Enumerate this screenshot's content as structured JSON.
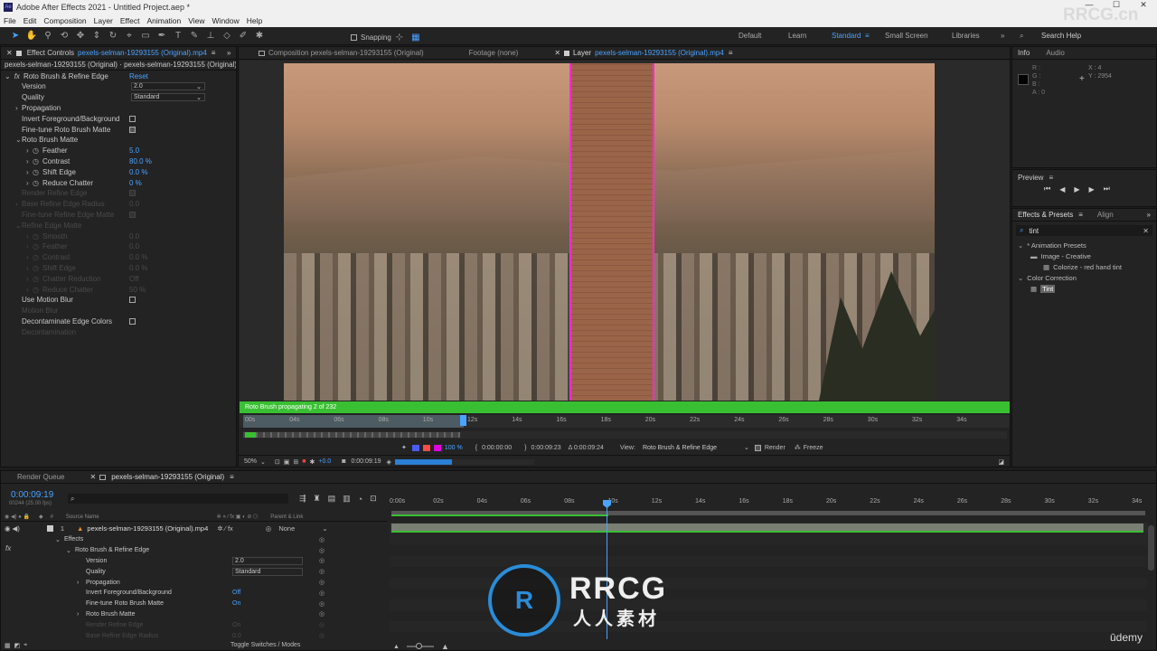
{
  "titlebar": {
    "title": "Adobe After Effects 2021 - Untitled Project.aep *",
    "minimize": "—",
    "maximize": "☐",
    "close": "✕"
  },
  "menu": [
    "File",
    "Edit",
    "Composition",
    "Layer",
    "Effect",
    "Animation",
    "View",
    "Window",
    "Help"
  ],
  "toolbar": {
    "snapping": "Snapping"
  },
  "workspaces": [
    "Default",
    "Learn",
    "Standard",
    "Small Screen",
    "Libraries"
  ],
  "search_help": "Search Help",
  "effect_controls": {
    "tab": "Effect Controls",
    "tab_file": "pexels-selman-19293155 (Original).mp4",
    "header": "pexels-selman-19293155 (Original) · pexels-selman-19293155 (Original).mp4",
    "effect_name": "Roto Brush & Refine Edge",
    "reset": "Reset",
    "rows": [
      {
        "label": "Version",
        "value": "2.0",
        "kind": "dropdown",
        "indent": 1
      },
      {
        "label": "Quality",
        "value": "Standard",
        "kind": "dropdown",
        "indent": 1
      },
      {
        "label": "Propagation",
        "value": "",
        "kind": "group",
        "indent": 1
      },
      {
        "label": "Invert Foreground/Background",
        "value": "",
        "kind": "checkbox",
        "indent": 1
      },
      {
        "label": "Fine-tune Roto Brush Matte",
        "value": "",
        "kind": "checkbox-on",
        "indent": 1
      },
      {
        "label": "Roto Brush Matte",
        "value": "",
        "kind": "group-open",
        "indent": 1
      },
      {
        "label": "Feather",
        "value": "5.0",
        "kind": "num",
        "indent": 2
      },
      {
        "label": "Contrast",
        "value": "80.0 %",
        "kind": "num",
        "indent": 2
      },
      {
        "label": "Shift Edge",
        "value": "0.0 %",
        "kind": "num",
        "indent": 2
      },
      {
        "label": "Reduce Chatter",
        "value": "0 %",
        "kind": "num",
        "indent": 2
      },
      {
        "label": "Render Refine Edge",
        "value": "",
        "kind": "checkbox-dim",
        "indent": 1
      },
      {
        "label": "Base Refine Edge Radius",
        "value": "0.0",
        "kind": "dim",
        "indent": 1
      },
      {
        "label": "Fine-tune Refine Edge Matte",
        "value": "",
        "kind": "checkbox-dim",
        "indent": 1
      },
      {
        "label": "Refine Edge Matte",
        "value": "",
        "kind": "dim",
        "indent": 1
      },
      {
        "label": "Smooth",
        "value": "0.0",
        "kind": "dim",
        "indent": 2
      },
      {
        "label": "Feather",
        "value": "0.0",
        "kind": "dim",
        "indent": 2
      },
      {
        "label": "Contrast",
        "value": "0.0 %",
        "kind": "dim",
        "indent": 2
      },
      {
        "label": "Shift Edge",
        "value": "0.0 %",
        "kind": "dim",
        "indent": 2
      },
      {
        "label": "Chatter Reduction",
        "value": "Off",
        "kind": "dim",
        "indent": 2
      },
      {
        "label": "Reduce Chatter",
        "value": "50 %",
        "kind": "dim",
        "indent": 2
      },
      {
        "label": "Use Motion Blur",
        "value": "",
        "kind": "checkbox",
        "indent": 1
      },
      {
        "label": "Motion Blur",
        "value": "",
        "kind": "dim",
        "indent": 1
      },
      {
        "label": "Decontaminate Edge Colors",
        "value": "",
        "kind": "checkbox",
        "indent": 1
      },
      {
        "label": "Decontamination",
        "value": "",
        "kind": "dim",
        "indent": 1
      }
    ]
  },
  "viewer": {
    "tab_comp": "Composition pexels-selman-19293155 (Original)",
    "tab_footage": "Footage (none)",
    "tab_layer": "Layer",
    "tab_layer_file": "pexels-selman-19293155 (Original).mp4",
    "status": "Roto Brush propagating 2 of 232",
    "status_progress": 1.0,
    "ruler": [
      "00s",
      "04s",
      "06s",
      "08s",
      "10s",
      "12s",
      "14s",
      "16s",
      "18s",
      "20s",
      "22s",
      "24s",
      "26s",
      "28s",
      "30s",
      "32s",
      "34s"
    ],
    "in_time": "0:00:00:00",
    "out_time": "0:00:09:23",
    "duration": "Δ 0:00:09:24",
    "zoom_pct": "100 %",
    "exposure": "+0.0",
    "view_label": "View:",
    "view_value": "Roto Brush & Refine Edge",
    "render": "Render",
    "freeze": "Freeze",
    "magnification": "50%",
    "current_time": "0:00:09:19",
    "cache_progress": 0.41
  },
  "info": {
    "tab_info": "Info",
    "tab_audio": "Audio",
    "r": "R :",
    "g": "G :",
    "b": "B :",
    "a": "A : 0",
    "x": "X : 4",
    "y": "Y : 2954"
  },
  "preview": {
    "title": "Preview"
  },
  "effects_presets": {
    "tab": "Effects & Presets",
    "tab_align": "Align",
    "search": "tint",
    "items": [
      {
        "label": "* Animation Presets",
        "level": 0
      },
      {
        "label": "Image - Creative",
        "level": 1
      },
      {
        "label": "Colorize - red hand tint",
        "level": 2
      },
      {
        "label": "Color Correction",
        "level": 0
      },
      {
        "label": "Tint",
        "level": 1
      }
    ]
  },
  "timeline": {
    "tab_render": "Render Queue",
    "tab_comp": "pexels-selman-19293155 (Original)",
    "timecode": "0:00:09:19",
    "fps": "00244 (25.00 fps)",
    "col_source": "Source Name",
    "col_parent": "Parent & Link",
    "layer_num": "1",
    "layer_name": "pexels-selman-19293155 (Original).mp4",
    "layer_parent": "None",
    "ruler": [
      "0:00s",
      "02s",
      "04s",
      "06s",
      "08s",
      "10s",
      "12s",
      "14s",
      "16s",
      "18s",
      "20s",
      "22s",
      "24s",
      "26s",
      "28s",
      "30s",
      "32s",
      "34s"
    ],
    "props": [
      {
        "label": "Effects",
        "value": "",
        "indent": 1
      },
      {
        "label": "Roto Brush & Refine Edge",
        "value": "",
        "indent": 2
      },
      {
        "label": "Version",
        "value": "2.0",
        "indent": 3,
        "dd": true
      },
      {
        "label": "Quality",
        "value": "Standard",
        "indent": 3,
        "dd": true
      },
      {
        "label": "Propagation",
        "value": "",
        "indent": 3
      },
      {
        "label": "Invert Foreground/Background",
        "value": "Off",
        "indent": 3
      },
      {
        "label": "Fine-tune Roto Brush Matte",
        "value": "On",
        "indent": 3
      },
      {
        "label": "Roto Brush Matte",
        "value": "",
        "indent": 3
      },
      {
        "label": "Render Refine Edge",
        "value": "On",
        "indent": 3,
        "dim": true
      },
      {
        "label": "Base Refine Edge Radius",
        "value": "0.0",
        "indent": 3,
        "dim": true
      }
    ],
    "toggle": "Toggle Switches / Modes"
  },
  "watermarks": {
    "top": "RRCG.cn",
    "center": "RRCG",
    "center_sub": "人人素材",
    "udemy": "ūdemy"
  }
}
